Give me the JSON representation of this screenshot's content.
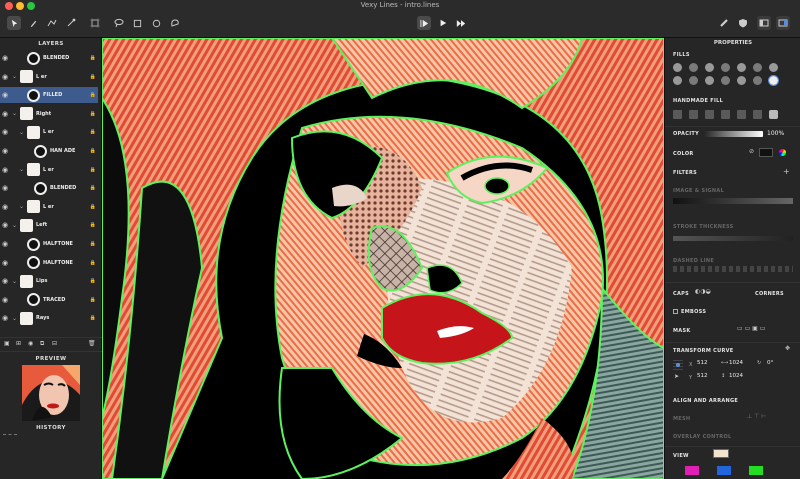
{
  "window": {
    "title": "Vexy Lines - intro.lines"
  },
  "toolbar": {
    "tools": [
      "select-icon",
      "pencil-icon",
      "pen-icon",
      "node-icon",
      "frame-icon",
      "lasso-icon",
      "rect-icon",
      "ellipse-icon",
      "shape-icon"
    ],
    "playback": [
      "play-frame-icon",
      "play-icon",
      "fast-forward-icon"
    ]
  },
  "layers_panel": {
    "title": "LAYERS",
    "items": [
      {
        "label": "BLENDED",
        "indent": 2,
        "kind": "fill"
      },
      {
        "label": "L er",
        "indent": 1,
        "kind": "group"
      },
      {
        "label": "FILLED",
        "indent": 2,
        "kind": "fill",
        "selected": true
      },
      {
        "label": "Right",
        "indent": 1,
        "kind": "group"
      },
      {
        "label": "L er",
        "indent": 2,
        "kind": "group"
      },
      {
        "label": "HAN ADE",
        "indent": 3,
        "kind": "fill"
      },
      {
        "label": "L er",
        "indent": 2,
        "kind": "group"
      },
      {
        "label": "BLENDED",
        "indent": 3,
        "kind": "fill"
      },
      {
        "label": "L er",
        "indent": 2,
        "kind": "group"
      },
      {
        "label": "Left",
        "indent": 1,
        "kind": "group"
      },
      {
        "label": "HALFTONE",
        "indent": 2,
        "kind": "fill"
      },
      {
        "label": "HALFTONE",
        "indent": 2,
        "kind": "fill"
      },
      {
        "label": "Lips",
        "indent": 1,
        "kind": "group"
      },
      {
        "label": "TRACED",
        "indent": 2,
        "kind": "fill"
      },
      {
        "label": "Rays",
        "indent": 1,
        "kind": "group"
      }
    ]
  },
  "preview_panel": {
    "title": "PREVIEW"
  },
  "history_panel": {
    "title": "HISTORY"
  },
  "properties": {
    "title": "PROPERTIES",
    "fills_label": "FILLS",
    "handmade_label": "HANDMADE FILL",
    "opacity_label": "OPACITY",
    "opacity_value": "100%",
    "color_label": "COLOR",
    "filters_label": "FILTERS",
    "image_signal_label": "IMAGE & SIGNAL",
    "stroke_thickness_label": "STROKE THICKNESS",
    "dashed_line_label": "DASHED LINE",
    "caps_label": "CAPS",
    "corners_label": "CORNERS",
    "emboss_label": "EMBOSS",
    "mask_label": "MASK",
    "transform_label": "TRANSFORM CURVE",
    "x_label": "X",
    "x_value": "512",
    "w_value": "1024",
    "angle_value": "0°",
    "y_label": "Y",
    "y_value": "512",
    "h_value": "1024",
    "align_label": "ALIGN AND ARRANGE",
    "mesh_label": "MESH",
    "overlay_label": "OVERLAY CONTROL",
    "view_label": "VIEW",
    "accent": "#5b8dd6",
    "swatches": [
      "#e01fb6",
      "#2266dd",
      "#22dd22"
    ]
  }
}
